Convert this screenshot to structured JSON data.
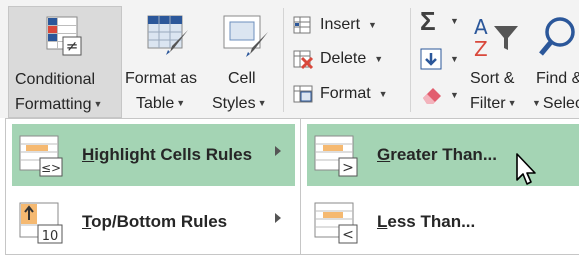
{
  "ribbon": {
    "conditional_formatting": {
      "line1": "Conditional",
      "line2": "Formatting"
    },
    "format_as_table": {
      "line1": "Format as",
      "line2": "Table"
    },
    "cell_styles": {
      "line1": "Cell",
      "line2": "Styles"
    },
    "insert": "Insert",
    "delete": "Delete",
    "format": "Format",
    "sort_filter": {
      "line1": "Sort &",
      "line2": "Filter"
    },
    "find_select": {
      "line1": "Find &",
      "line2": "Select"
    }
  },
  "menu": {
    "items": [
      {
        "underlined": "H",
        "rest": "ighlight Cells Rules",
        "has_submenu": true,
        "highlighted": true
      },
      {
        "underlined": "T",
        "rest": "op/Bottom Rules",
        "has_submenu": true,
        "highlighted": false
      }
    ]
  },
  "submenu": {
    "items": [
      {
        "underlined": "G",
        "rest": "reater Than...",
        "highlighted": true
      },
      {
        "underlined": "L",
        "rest": "ess Than...",
        "highlighted": false
      }
    ]
  },
  "colors": {
    "highlight": "#a4d4b4",
    "ribbon_bg": "#f3f3f3",
    "accent_blue": "#2b579a",
    "orange": "#f5b971"
  },
  "icons": [
    "conditional-formatting-icon",
    "format-as-table-icon",
    "cell-styles-icon",
    "insert-icon",
    "delete-icon",
    "format-icon",
    "autosum-icon",
    "fill-icon",
    "clear-icon",
    "sort-filter-icon",
    "find-select-icon",
    "highlight-cells-icon",
    "top-bottom-icon",
    "greater-than-icon",
    "less-than-icon",
    "mouse-pointer-icon"
  ]
}
